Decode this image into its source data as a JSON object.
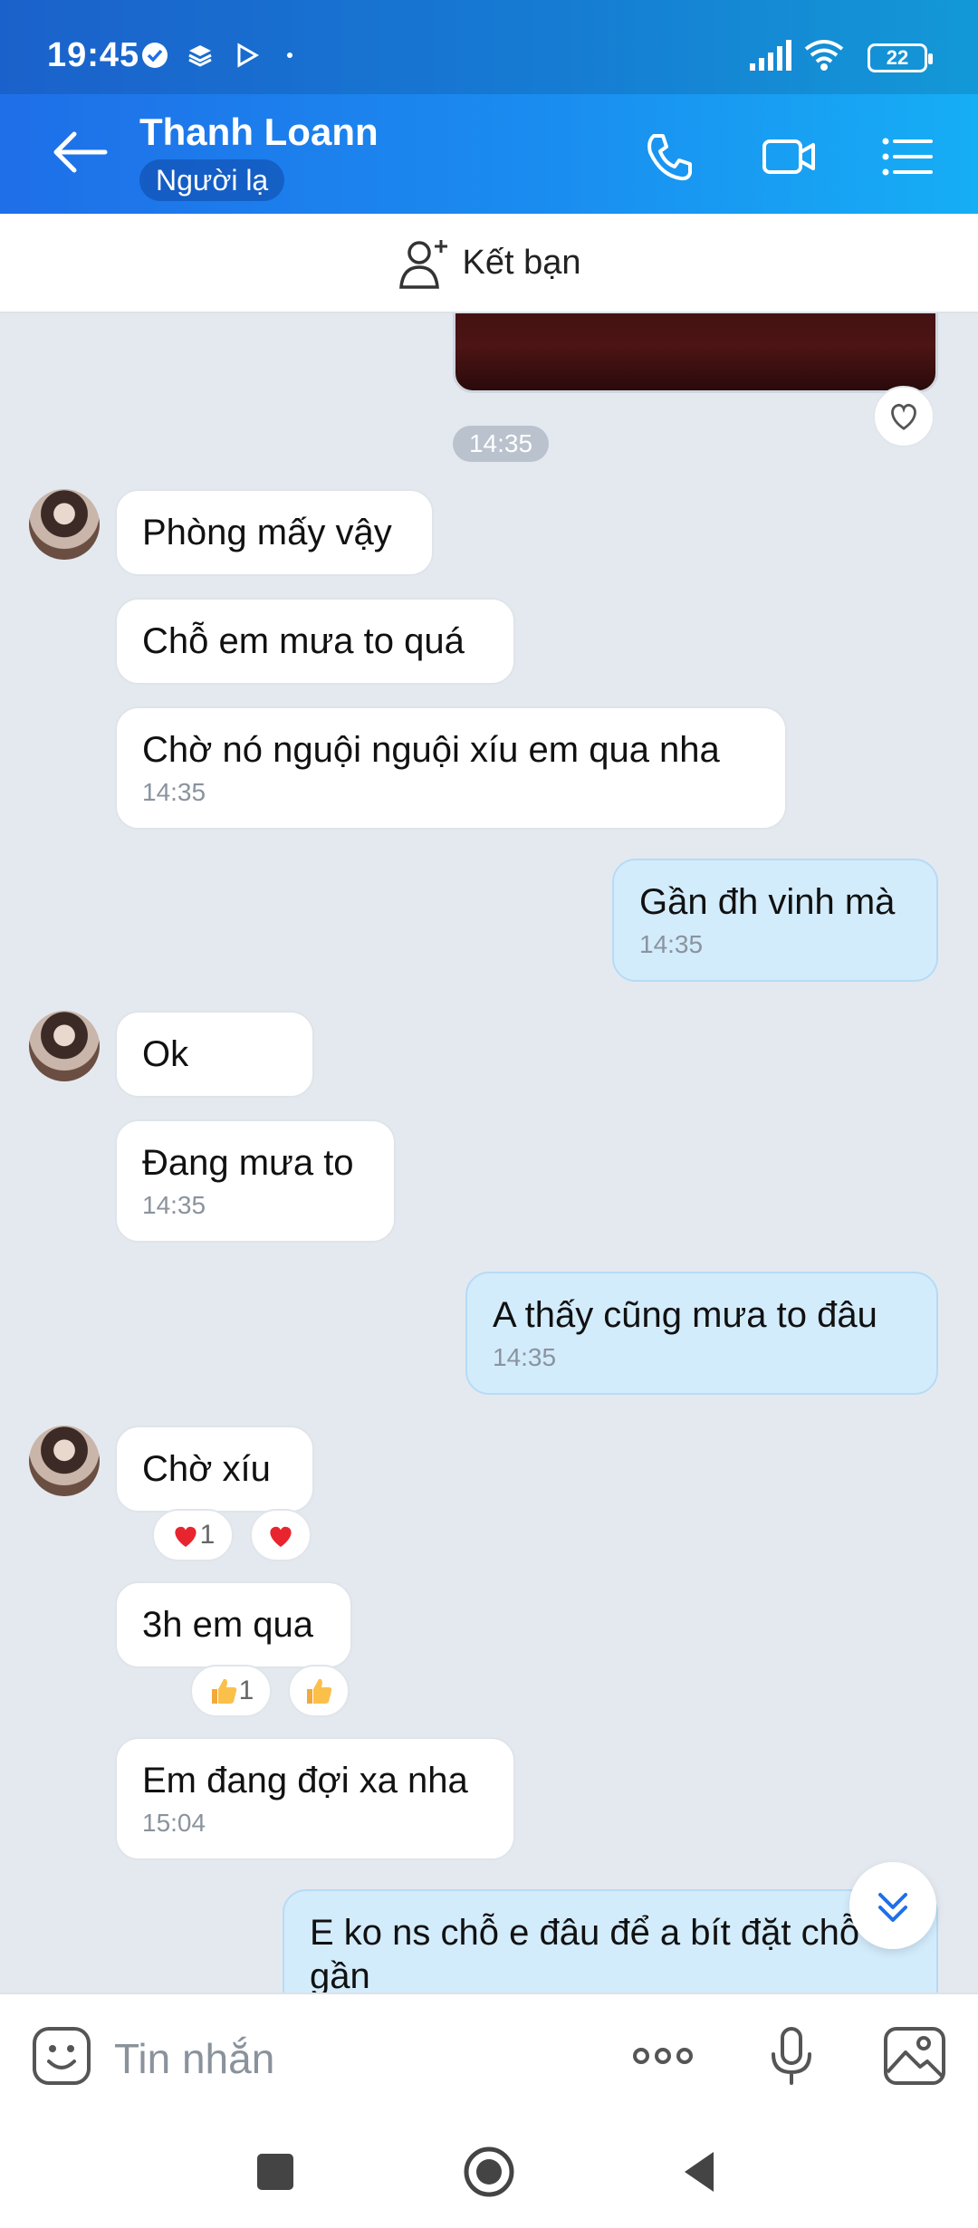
{
  "status": {
    "time": "19:45",
    "battery": "22"
  },
  "header": {
    "title": "Thanh Loann",
    "badge": "Người lạ"
  },
  "add_friend": {
    "label": "Kết bạn"
  },
  "chat": {
    "top_time": "14:35",
    "messages": [
      {
        "dir": "in",
        "text": "Phòng mấy vậy"
      },
      {
        "dir": "in",
        "text": "Chỗ em mưa to quá"
      },
      {
        "dir": "in",
        "text": "Chờ nó nguội nguội xíu em qua nha",
        "time": "14:35"
      },
      {
        "dir": "out",
        "text": "Gần đh vinh mà",
        "time": "14:35"
      },
      {
        "dir": "in",
        "text": "Ok"
      },
      {
        "dir": "in",
        "text": "Đang mưa to",
        "time": "14:35"
      },
      {
        "dir": "out",
        "text": "A thấy cũng mưa to đâu",
        "time": "14:35"
      },
      {
        "dir": "in",
        "text": "Chờ xíu",
        "reaction_count": "1"
      },
      {
        "dir": "in",
        "text": "3h em qua",
        "reaction_count": "1"
      },
      {
        "dir": "in",
        "text": "Em đang đợi xa nha",
        "time": "15:04"
      },
      {
        "dir": "out",
        "text": "E ko ns chỗ e đâu để a bít đặt chỗ gần"
      }
    ]
  },
  "input": {
    "placeholder": "Tin nhắn"
  },
  "colors": {
    "header_start": "#1f6fe8",
    "header_end": "#16aef5",
    "bubble_out": "#d3ecfc",
    "bubble_in": "#ffffff",
    "chat_bg": "#e4e9f0"
  }
}
